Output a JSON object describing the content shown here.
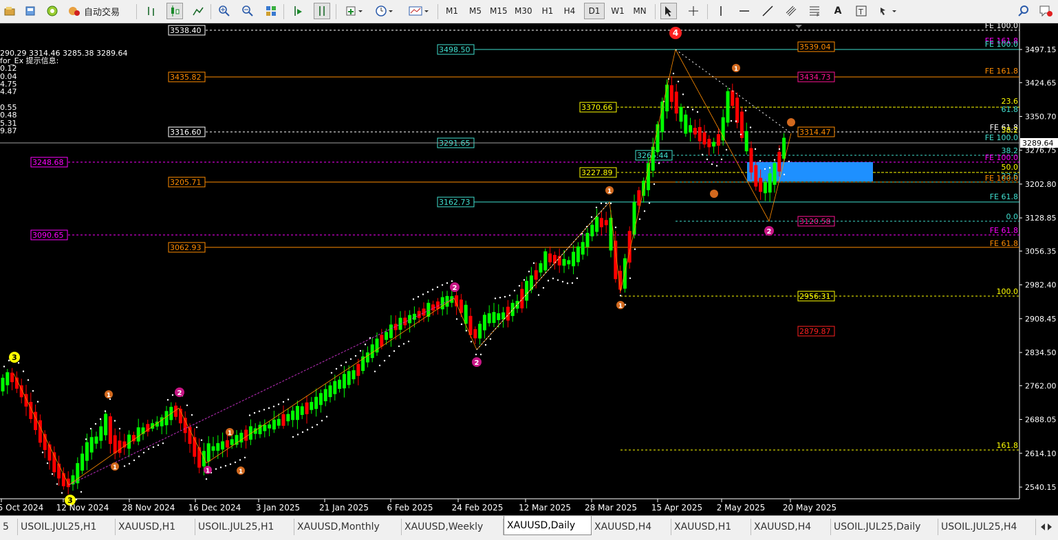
{
  "toolbar": {
    "autotrade_label": "自动交易",
    "timeframes": [
      "M1",
      "M5",
      "M15",
      "M30",
      "H1",
      "H4",
      "D1",
      "W1",
      "MN"
    ],
    "active_timeframe": "D1",
    "text_tool": "A"
  },
  "chart": {
    "ohlc_text": "290.29 3314.46 3285.38 3289.64",
    "indicator_title": "for_Ex 提示信息:",
    "indicator_values": [
      "0.12",
      "0.04",
      "4.75",
      "4.47",
      "0.55",
      "0.48",
      "5.31",
      "9.87"
    ],
    "current_price": "3289.64",
    "price_scale": [
      "3497.15",
      "3424.65",
      "3350.70",
      "3276.75",
      "3202.80",
      "3128.85",
      "3056.35",
      "2982.40",
      "2908.45",
      "2834.50",
      "2762.00",
      "2688.05",
      "2614.10",
      "2540.15"
    ],
    "date_axis": [
      "5 Oct 2024",
      "12 Nov 2024",
      "28 Nov 2024",
      "16 Dec 2024",
      "3 Jan 2025",
      "21 Jan 2025",
      "6 Feb 2025",
      "24 Feb 2025",
      "12 Mar 2025",
      "28 Mar 2025",
      "15 Apr 2025",
      "2 May 2025",
      "20 May 2025"
    ],
    "level_labels": [
      {
        "text": "3538.40",
        "color": "#ffffff"
      },
      {
        "text": "3498.50",
        "color": "#40e0d0"
      },
      {
        "text": "3435.82",
        "color": "#ff8c00"
      },
      {
        "text": "3370.66",
        "color": "#ffff00"
      },
      {
        "text": "3316.60",
        "color": "#ffffff"
      },
      {
        "text": "3291.65",
        "color": "#40e0d0"
      },
      {
        "text": "3248.68",
        "color": "#ff00ff"
      },
      {
        "text": "3265.44",
        "color": "#40e0d0"
      },
      {
        "text": "3227.89",
        "color": "#ffff00"
      },
      {
        "text": "3205.71",
        "color": "#ff8c00"
      },
      {
        "text": "3162.73",
        "color": "#40e0d0"
      },
      {
        "text": "3090.65",
        "color": "#ff00ff"
      },
      {
        "text": "3062.93",
        "color": "#ff8c00"
      },
      {
        "text": "3539.04",
        "color": "#ff8c00"
      },
      {
        "text": "3434.73",
        "color": "#ff1493"
      },
      {
        "text": "3314.47",
        "color": "#ff8c00"
      },
      {
        "text": "3120.58",
        "color": "#ff1493"
      },
      {
        "text": "2956.31",
        "color": "#ffff00"
      },
      {
        "text": "2879.87",
        "color": "#ff2020"
      }
    ],
    "fib_labels": [
      {
        "text": "FE 100.0",
        "color": "#ffffff"
      },
      {
        "text": "FE 161.8",
        "color": "#ff00ff"
      },
      {
        "text": "FE 100.0",
        "color": "#40e0d0"
      },
      {
        "text": "FE 161.8",
        "color": "#ff8c00"
      },
      {
        "text": "23.6",
        "color": "#ffff00"
      },
      {
        "text": "61.8",
        "color": "#40e0d0"
      },
      {
        "text": "FE 61.8",
        "color": "#ffffff"
      },
      {
        "text": "38.2",
        "color": "#ffff00"
      },
      {
        "text": "FE 100.0",
        "color": "#40e0d0"
      },
      {
        "text": "38.2",
        "color": "#40e0d0"
      },
      {
        "text": "FE 100.0",
        "color": "#ff00ff"
      },
      {
        "text": "50.0",
        "color": "#ffff00"
      },
      {
        "text": "23.6",
        "color": "#40e0d0"
      },
      {
        "text": "FE 100.0",
        "color": "#ff8c00"
      },
      {
        "text": "FE 61.8",
        "color": "#40e0d0"
      },
      {
        "text": "0.0",
        "color": "#40e0d0"
      },
      {
        "text": "FE 61.8",
        "color": "#ff00ff"
      },
      {
        "text": "FE 61.8",
        "color": "#ff8c00"
      },
      {
        "text": "100.0",
        "color": "#ffff00"
      },
      {
        "text": "161.8",
        "color": "#ffff00"
      }
    ],
    "wave_labels": [
      "3",
      "3",
      "4",
      "2",
      "2",
      "2",
      "2",
      "1",
      "1",
      "1",
      "1",
      "1",
      "1",
      "1",
      "1"
    ]
  },
  "tabs": [
    "5",
    "USOIL.JUL25,H1",
    "XAUUSD,H1",
    "USOIL.JUL25,H1",
    "XAUUSD,Monthly",
    "XAUUSD,Weekly",
    "XAUUSD,Daily",
    "XAUUSD,H4",
    "XAUUSD,H1",
    "XAUUSD,H4",
    "USOIL.JUL25,Daily",
    "USOIL.JUL25,H4"
  ],
  "active_tab": "XAUUSD,Daily",
  "colors": {
    "bull": "#00ff00",
    "bear": "#ff0000",
    "background": "#000000",
    "grid": "#ffffff"
  }
}
